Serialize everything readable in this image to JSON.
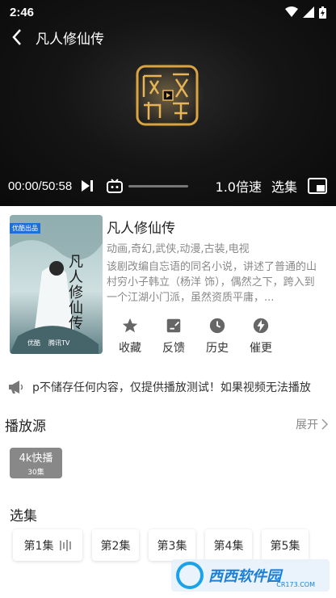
{
  "status": {
    "time": "2:46"
  },
  "player": {
    "title": "凡人修仙传",
    "time": "00:00/50:58",
    "speed": "1.0倍速",
    "episodes_label": "选集",
    "progress": 0.0
  },
  "show": {
    "title": "凡人修仙传",
    "tags": "动画,奇幻,武侠,动漫,古装,电视",
    "description": "该剧改编自忘语的同名小说，讲述了普通的山村穷小子韩立（杨洋 饰），偶然之下，跨入到一个江湖小门派，虽然资质平庸，...",
    "poster": {
      "badge": "优酷出品",
      "title": "凡人修仙传",
      "brand1": "优酷",
      "brand2": "腾讯TV"
    }
  },
  "actions": [
    {
      "label": "收藏",
      "icon": "star-icon"
    },
    {
      "label": "反馈",
      "icon": "feedback-icon"
    },
    {
      "label": "历史",
      "icon": "clock-icon"
    },
    {
      "label": "催更",
      "icon": "bolt-icon"
    }
  ],
  "notice": "p不储存任何内容，仅提供播放测试！如果视频无法播放",
  "source": {
    "title": "播放源",
    "expand": "展开",
    "chip": {
      "name": "4k快播",
      "count": "30集"
    }
  },
  "episodes": {
    "title": "选集",
    "items": [
      "第1集",
      "第2集",
      "第3集",
      "第4集",
      "第5集"
    ]
  },
  "watermark": {
    "text": "西西软件园",
    "sub": "CR173.COM"
  },
  "colors": {
    "accent": "#888888",
    "player_bg": "#121212",
    "logo_gold": "#d9a441"
  }
}
